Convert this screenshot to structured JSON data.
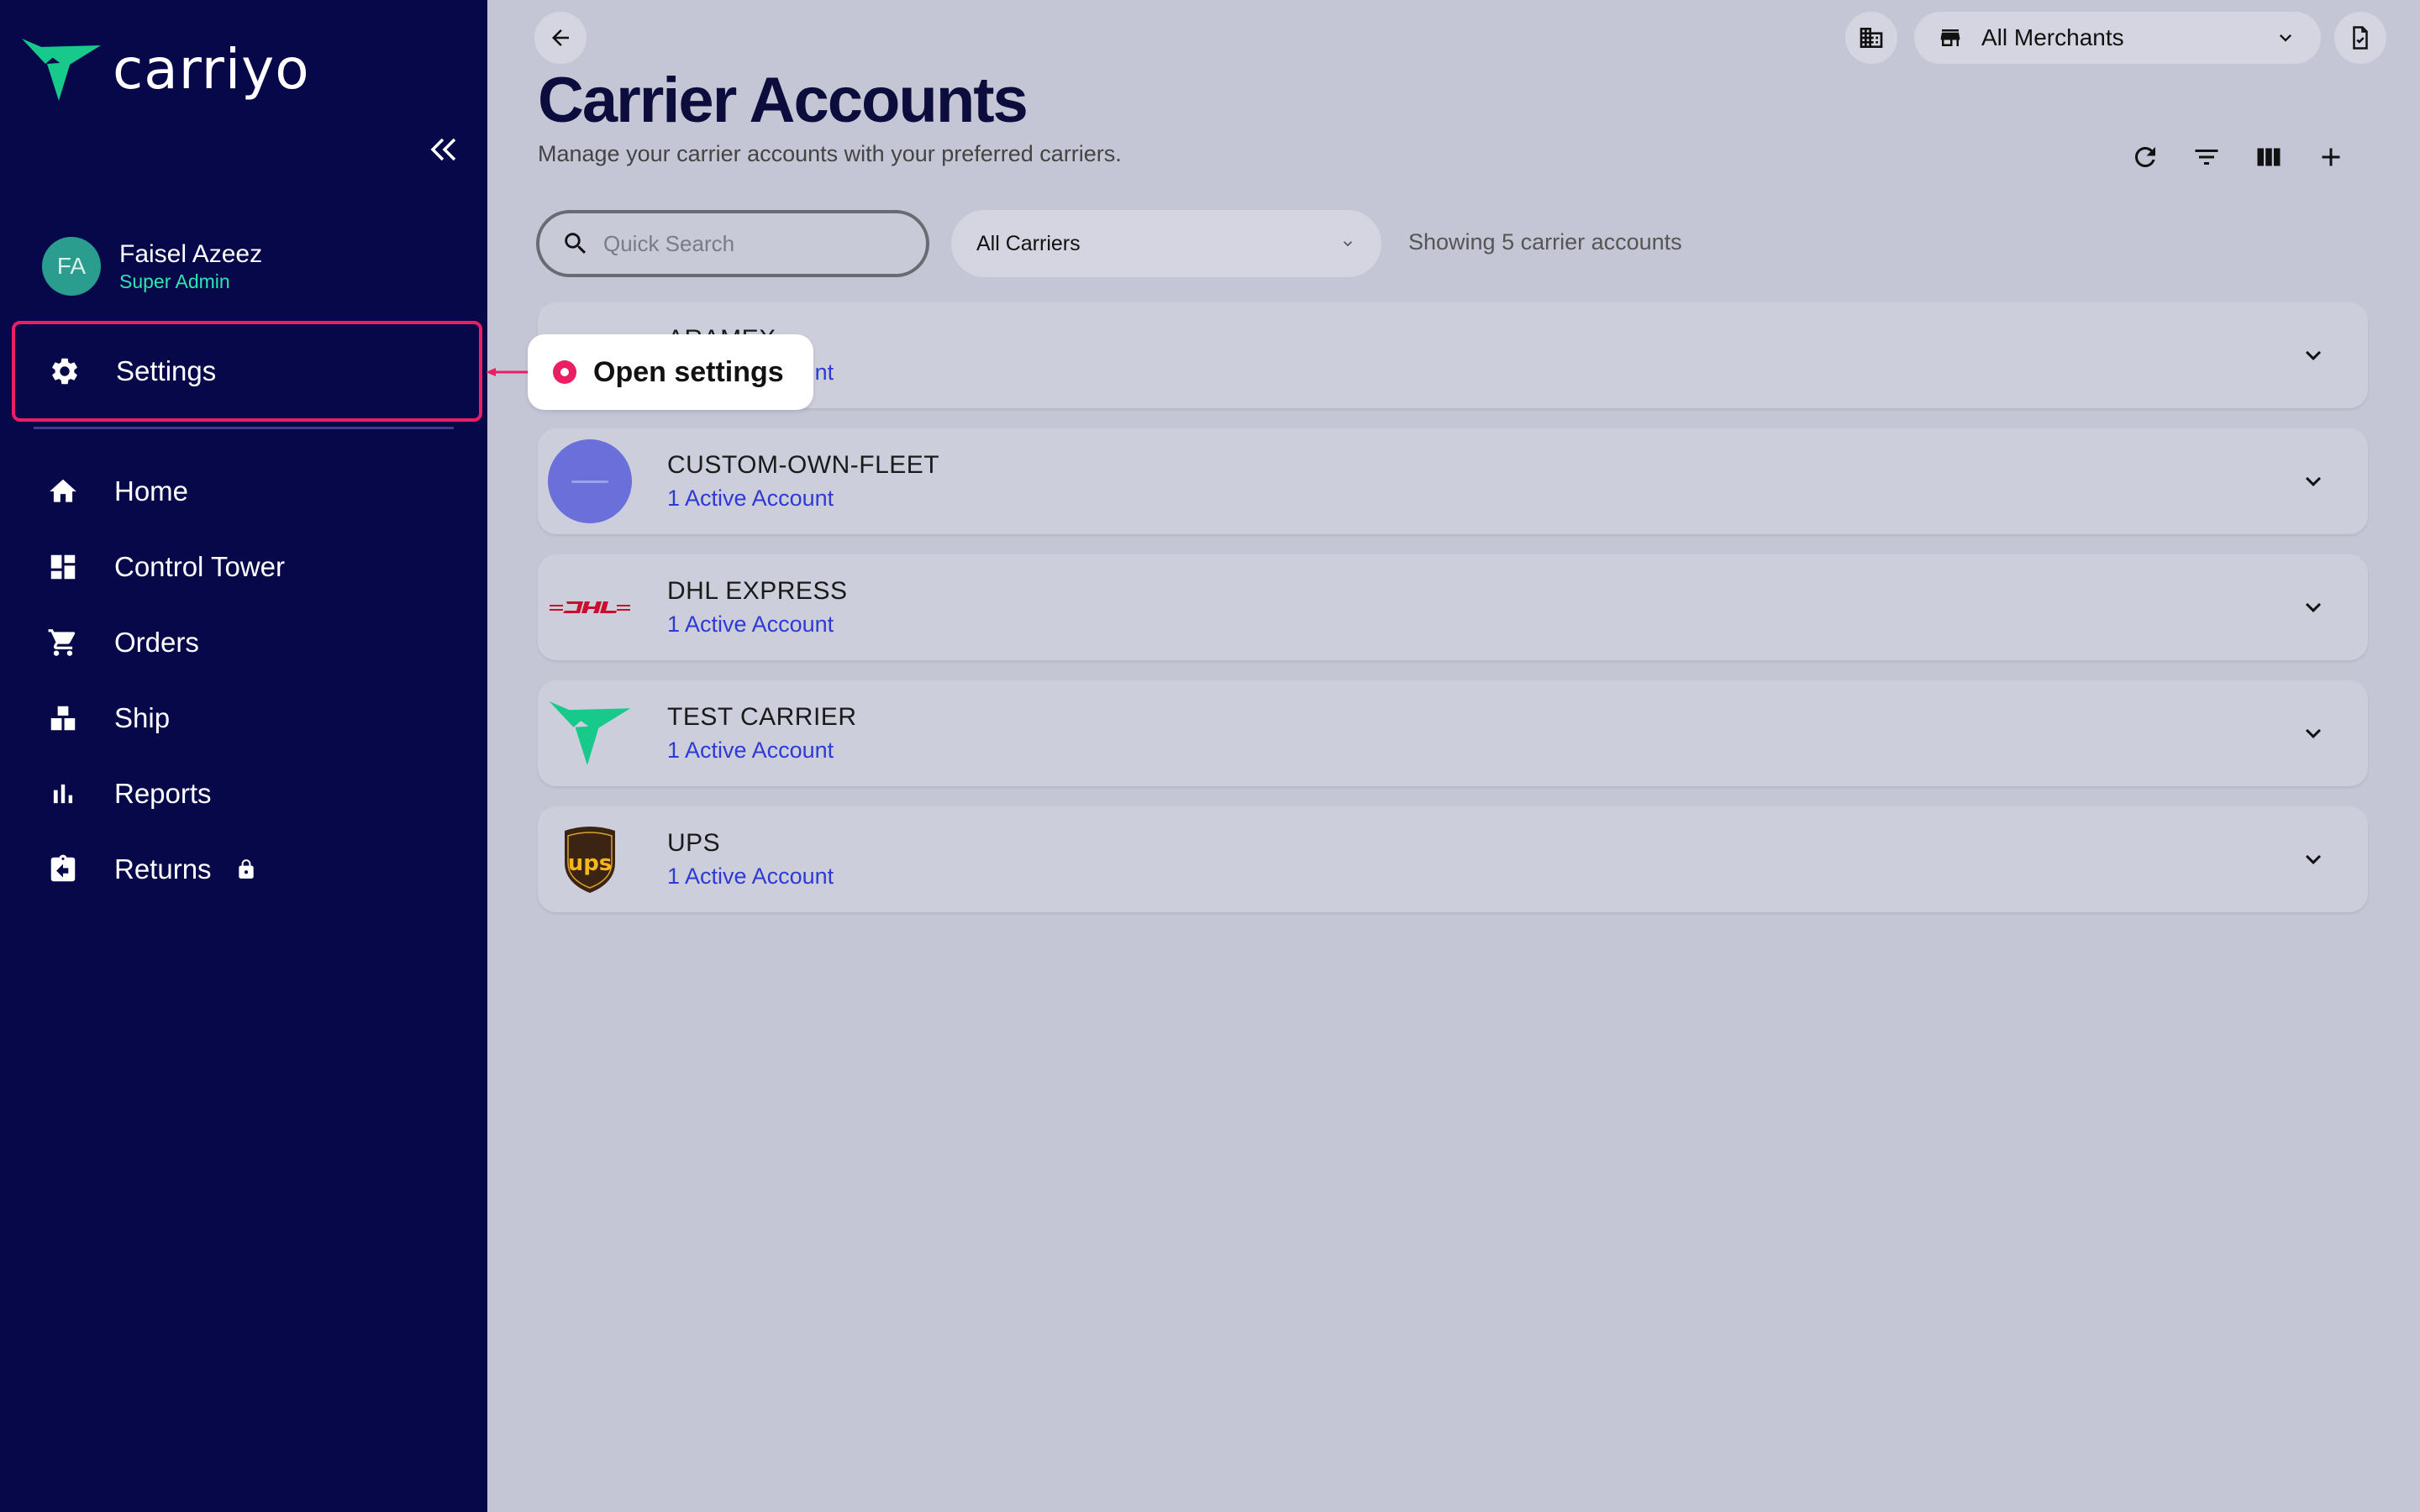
{
  "app": {
    "logo_text": "carriyo"
  },
  "user": {
    "initials": "FA",
    "name": "Faisel Azeez",
    "role": "Super Admin"
  },
  "sidebar": {
    "settings_label": "Settings",
    "items": [
      {
        "label": "Home",
        "icon": "home-icon"
      },
      {
        "label": "Control Tower",
        "icon": "dashboard-icon"
      },
      {
        "label": "Orders",
        "icon": "cart-icon"
      },
      {
        "label": "Ship",
        "icon": "boxes-icon"
      },
      {
        "label": "Reports",
        "icon": "bar-chart-icon"
      },
      {
        "label": "Returns",
        "icon": "return-icon",
        "locked": true
      }
    ]
  },
  "header": {
    "merchant_select": "All Merchants",
    "title": "Carrier Accounts",
    "subtitle": "Manage your carrier accounts with your preferred carriers."
  },
  "filters": {
    "search_placeholder": "Quick Search",
    "carrier_select": "All Carriers",
    "showing_text": "Showing 5 carrier accounts"
  },
  "carriers": [
    {
      "name": "ARAMEX",
      "status": "1 Active Account"
    },
    {
      "name": "CUSTOM-OWN-FLEET",
      "status": "1 Active Account"
    },
    {
      "name": "DHL EXPRESS",
      "status": "1 Active Account"
    },
    {
      "name": "TEST CARRIER",
      "status": "1 Active Account"
    },
    {
      "name": "UPS",
      "status": "1 Active Account"
    }
  ],
  "callout": {
    "text": "Open settings"
  },
  "colors": {
    "sidebar_bg": "#07084a",
    "accent": "#e91e63",
    "link": "#2d3ad6",
    "brand_green": "#17c98a"
  }
}
